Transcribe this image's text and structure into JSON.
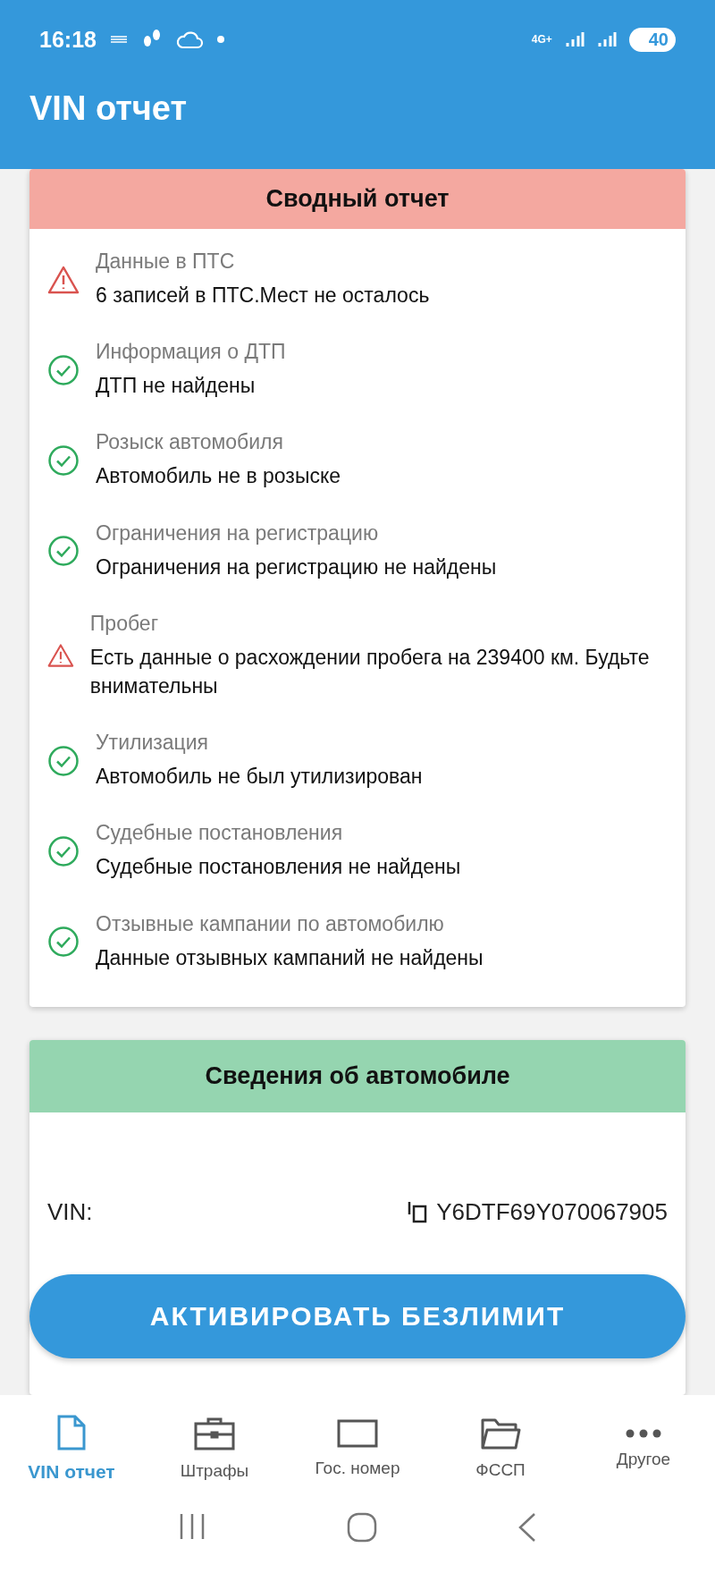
{
  "status_bar": {
    "time": "16:18",
    "network": "4G+",
    "battery": "40"
  },
  "app_bar": {
    "title": "VIN отчет"
  },
  "summary": {
    "title": "Сводный отчет",
    "items": [
      {
        "kind": "warning",
        "label": "Данные в ПТС",
        "value": "6 записей в ПТС.Мест не осталось"
      },
      {
        "kind": "ok",
        "label": "Информация о ДТП",
        "value": "ДТП не найдены"
      },
      {
        "kind": "ok",
        "label": "Розыск автомобиля",
        "value": "Автомобиль не в розыске"
      },
      {
        "kind": "ok",
        "label": "Ограничения на регистрацию",
        "value": "Ограничения на регистрацию не найдены"
      },
      {
        "kind": "warning",
        "label": "Пробег",
        "value": "Есть данные о расхождении пробега на 239400 км. Будьте внимательны"
      },
      {
        "kind": "ok",
        "label": "Утилизация",
        "value": "Автомобиль не был утилизирован"
      },
      {
        "kind": "ok",
        "label": "Судебные постановления",
        "value": "Судебные постановления не найдены"
      },
      {
        "kind": "ok",
        "label": "Отзывные кампании по автомобилю",
        "value": "Данные отзывных кампаний не найдены"
      }
    ]
  },
  "details": {
    "title": "Сведения об автомобиле",
    "rows": [
      {
        "label": "VIN:",
        "value": "Y6DTF69Y070067905"
      }
    ]
  },
  "action_button": "АКТИВИРОВАТЬ БЕЗЛИМИТ",
  "nav": [
    {
      "kind": "file",
      "label": "VIN отчет",
      "selected": true
    },
    {
      "kind": "briefcase",
      "label": "Штрафы",
      "selected": false
    },
    {
      "kind": "plate",
      "label": "Гос. номер",
      "selected": false
    },
    {
      "kind": "folder",
      "label": "ФССП",
      "selected": false
    },
    {
      "kind": "more",
      "label": "Другое",
      "selected": false
    }
  ]
}
